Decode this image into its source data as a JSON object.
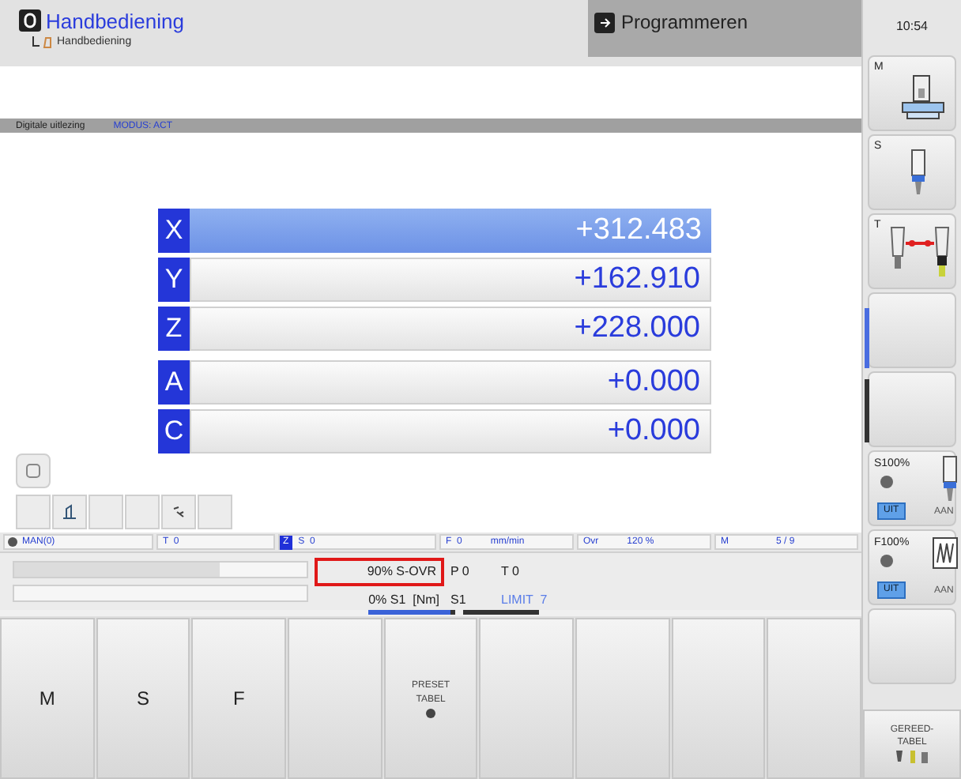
{
  "header": {
    "mode_title": "Handbediening",
    "breadcrumb": "Handbediening",
    "other_mode": "Programmeren"
  },
  "status_strip": {
    "label": "Digitale uitlezing",
    "mode": "MODUS: ACT"
  },
  "axes": [
    {
      "letter": "X",
      "value": "+312.483",
      "selected": true
    },
    {
      "letter": "Y",
      "value": "+162.910",
      "selected": false
    },
    {
      "letter": "Z",
      "value": "+228.000",
      "selected": false
    },
    {
      "letter": "A",
      "value": "+0.000",
      "selected": false
    },
    {
      "letter": "C",
      "value": "+0.000",
      "selected": false
    }
  ],
  "status_bar": {
    "mode": "MAN(0)",
    "tool": "T  0",
    "tool_axis": "Z",
    "spindle": "S  0",
    "feed": "F  0",
    "feed_unit": "mm/min",
    "override_label": "Ovr",
    "override": "120 %",
    "m_label": "M",
    "m_value": "5 / 9"
  },
  "info": {
    "bars": [
      {
        "level": 0.7
      },
      {
        "level": 0
      }
    ],
    "s_ovr": "90% S-OVR",
    "s_ovr_highlighted": true,
    "p": "P 0",
    "t": "T 0",
    "torque": "0% S1  [Nm]",
    "s1": "S1",
    "limit": "LIMIT  7"
  },
  "right_panel": {
    "time": "10:54",
    "softkeys": [
      {
        "kind": "machine",
        "label": "M"
      },
      {
        "kind": "spindle",
        "label": "S"
      },
      {
        "kind": "tool",
        "label": "T"
      },
      {
        "kind": "empty"
      },
      {
        "kind": "empty"
      },
      {
        "kind": "override",
        "label": "S100%",
        "off": "UIT",
        "on": "AAN",
        "off_selected": true
      },
      {
        "kind": "feed",
        "label": "F100%",
        "off": "UIT",
        "on": "AAN",
        "off_selected": true
      },
      {
        "kind": "empty"
      }
    ]
  },
  "softkeys": [
    {
      "kind": "text",
      "label": "M"
    },
    {
      "kind": "text",
      "label": "S"
    },
    {
      "kind": "text",
      "label": "F"
    },
    {
      "kind": "blank"
    },
    {
      "kind": "text",
      "label": "PRESET TABEL",
      "icon": true
    },
    {
      "kind": "blank"
    },
    {
      "kind": "blank"
    },
    {
      "kind": "blank"
    },
    {
      "kind": "blank"
    }
  ],
  "corner_softkey": {
    "label": "GEREED-\nTABEL"
  }
}
